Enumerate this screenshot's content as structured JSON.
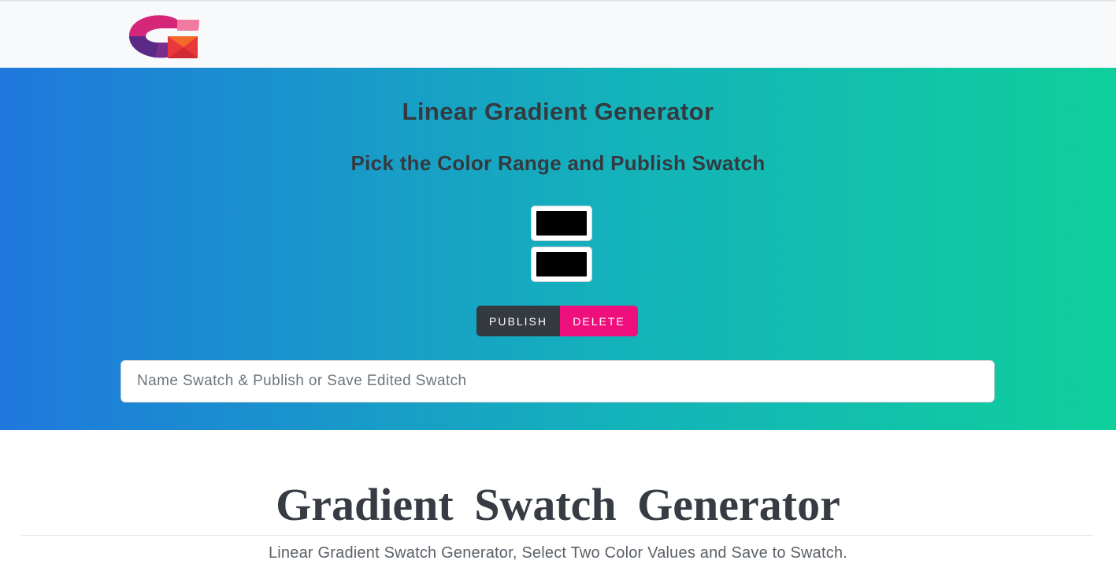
{
  "brand": {
    "logo_icon": "gradient-g-logo-icon",
    "colors": {
      "magenta": "#d6267a",
      "purple": "#6a2c8f",
      "pink": "#f06a94",
      "red": "#e8383a",
      "orange": "#f26b2b"
    }
  },
  "hero": {
    "title": "Linear Gradient Generator",
    "subtitle": "Pick the Color Range and Publish Swatch",
    "gradient_start": "#1f78dd",
    "gradient_end": "#0fcf9c",
    "color_inputs": [
      {
        "value": "#000000"
      },
      {
        "value": "#000000"
      }
    ],
    "buttons": {
      "publish": "PUBLISH",
      "delete": "DELETE"
    },
    "name_input": {
      "placeholder": "Name Swatch & Publish or Save Edited Swatch",
      "value": ""
    }
  },
  "content": {
    "title": "Gradient Swatch Generator",
    "lead": "Linear Gradient Swatch Generator, Select Two Color Values and Save to Swatch."
  }
}
